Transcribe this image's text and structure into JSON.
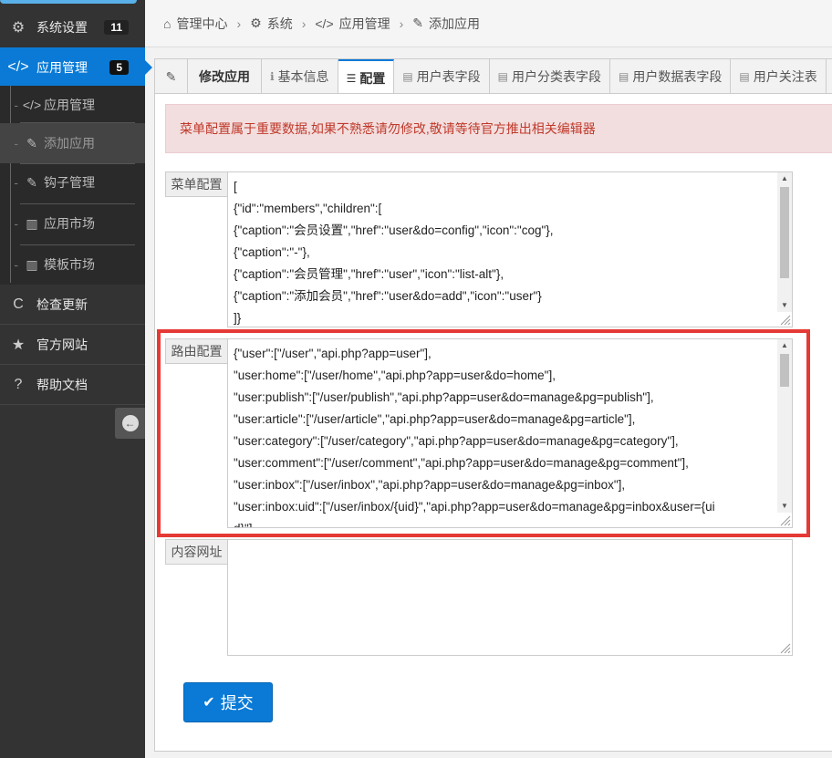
{
  "sidebar": {
    "items": [
      {
        "icon": "gear-icon",
        "glyph": "⚙",
        "label": "系统设置",
        "badge": "11"
      },
      {
        "icon": "code-icon",
        "glyph": "</>",
        "label": "应用管理",
        "badge": "5"
      },
      {
        "icon": "refresh-icon",
        "glyph": "C",
        "label": "检查更新"
      },
      {
        "icon": "star-icon",
        "glyph": "★",
        "label": "官方网站"
      },
      {
        "icon": "question-icon",
        "glyph": "?",
        "label": "帮助文档"
      }
    ],
    "submenu": [
      {
        "icon": "code-icon",
        "glyph": "</>",
        "label": "应用管理"
      },
      {
        "icon": "edit-icon",
        "glyph": "✎",
        "label": "添加应用"
      },
      {
        "icon": "plug-icon",
        "glyph": "✎",
        "label": "钩子管理"
      },
      {
        "icon": "bank-icon",
        "glyph": "▥",
        "label": "应用市场"
      },
      {
        "icon": "bank-icon",
        "glyph": "▥",
        "label": "模板市场"
      }
    ]
  },
  "breadcrumb": {
    "items": [
      {
        "icon": "home-icon",
        "glyph": "⌂",
        "label": "管理中心"
      },
      {
        "icon": "gear-icon",
        "glyph": "⚙",
        "label": "系统"
      },
      {
        "icon": "code-icon",
        "glyph": "</>",
        "label": "应用管理"
      },
      {
        "icon": "edit-icon",
        "glyph": "✎",
        "label": "添加应用"
      }
    ]
  },
  "tabs": {
    "first_glyph": "✎",
    "items": [
      {
        "label": "修改应用",
        "glyph": ""
      },
      {
        "label": "基本信息",
        "glyph": "ℹ"
      },
      {
        "label": "配置",
        "glyph": "☰"
      },
      {
        "label": "用户表字段",
        "glyph": "▤"
      },
      {
        "label": "用户分类表字段",
        "glyph": "▤"
      },
      {
        "label": "用户数据表字段",
        "glyph": "▤"
      },
      {
        "label": "用户关注表",
        "glyph": "▤"
      }
    ]
  },
  "alert": {
    "text": "菜单配置属于重要数据,如果不熟悉请勿修改,敬请等待官方推出相关编辑器"
  },
  "fields": {
    "menu": {
      "label": "菜单配置",
      "lines": [
        "[",
        "{\"id\":\"members\",\"children\":[",
        "{\"caption\":\"会员设置\",\"href\":\"user&do=config\",\"icon\":\"cog\"},",
        "{\"caption\":\"-\"},",
        "{\"caption\":\"会员管理\",\"href\":\"user\",\"icon\":\"list-alt\"},",
        "{\"caption\":\"添加会员\",\"href\":\"user&do=add\",\"icon\":\"user\"}",
        "]}"
      ]
    },
    "route": {
      "label": "路由配置",
      "lines": [
        "{\"user\":[\"/user\",\"api.php?app=user\"],",
        "\"user:home\":[\"/user/home\",\"api.php?app=user&do=home\"],",
        "\"user:publish\":[\"/user/publish\",\"api.php?app=user&do=manage&pg=publish\"],",
        "\"user:article\":[\"/user/article\",\"api.php?app=user&do=manage&pg=article\"],",
        "\"user:category\":[\"/user/category\",\"api.php?app=user&do=manage&pg=category\"],",
        "\"user:comment\":[\"/user/comment\",\"api.php?app=user&do=manage&pg=comment\"],",
        "\"user:inbox\":[\"/user/inbox\",\"api.php?app=user&do=manage&pg=inbox\"],",
        "\"user:inbox:uid\":[\"/user/inbox/{uid}\",\"api.php?app=user&do=manage&pg=inbox&user={ui",
        "d}\"]"
      ]
    },
    "url": {
      "label": "内容网址",
      "value": ""
    }
  },
  "submit": {
    "label": "提交",
    "glyph": "✔"
  },
  "colors": {
    "accent": "#0a7ad6",
    "alert_bg": "#f2dede",
    "alert_text": "#c0392b",
    "highlight": "#e53935",
    "sidebar": "#333333"
  }
}
